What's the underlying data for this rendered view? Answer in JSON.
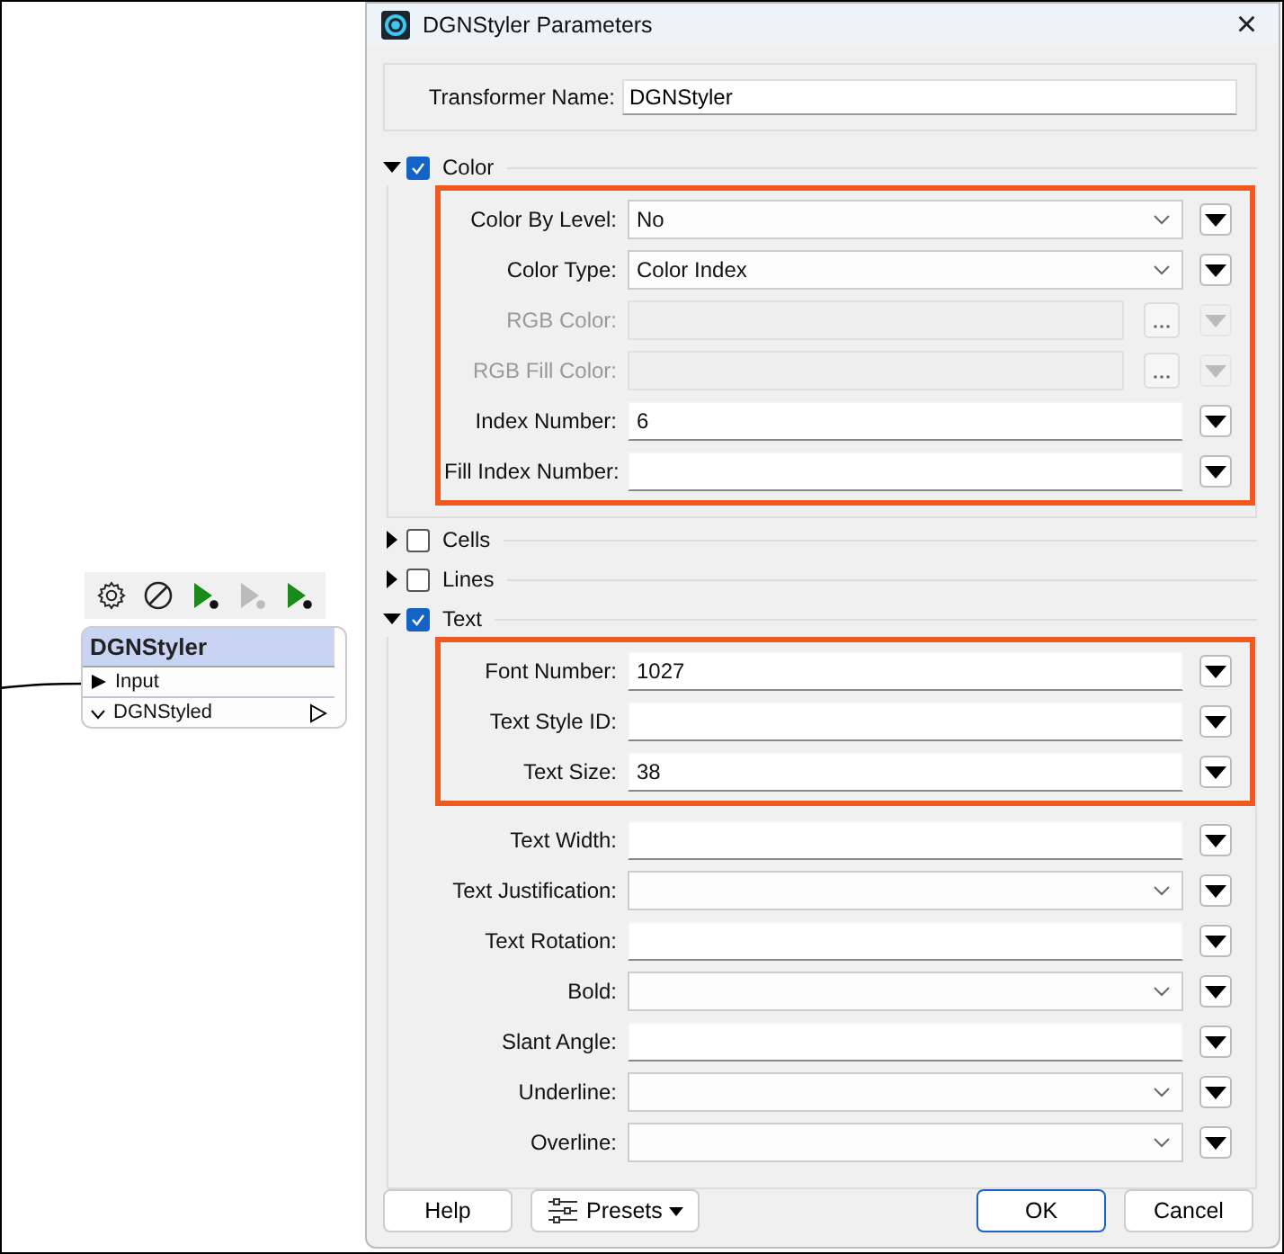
{
  "canvas": {
    "toolbar": [
      {
        "kind": "settings"
      },
      {
        "kind": "disable"
      },
      {
        "kind": "run",
        "disabled": false
      },
      {
        "kind": "run",
        "disabled": true
      },
      {
        "kind": "run",
        "disabled": false
      }
    ],
    "node": {
      "title": "DGNStyler",
      "selected": true,
      "input": "Input",
      "output": "DGNStyled"
    }
  },
  "dialog": {
    "title": "DGNStyler Parameters",
    "close": "×",
    "transformer_name": {
      "label": "Transformer Name:",
      "value": "DGNStyler"
    },
    "groups": [
      {
        "label": "Color",
        "checked": true,
        "expanded": true,
        "blocks": [
          {
            "highlighted": true,
            "params": [
              {
                "label": "Color By Level:",
                "kind": "select",
                "value": "No",
                "disabled": false
              },
              {
                "label": "Color Type:",
                "kind": "select",
                "value": "Color Index",
                "disabled": false
              },
              {
                "label": "RGB Color:",
                "kind": "color",
                "disabled": true
              },
              {
                "label": "RGB Fill Color:",
                "kind": "color",
                "disabled": true
              },
              {
                "label": "Index Number:",
                "kind": "text",
                "value": "6",
                "disabled": false
              },
              {
                "label": "Fill Index Number:",
                "kind": "text",
                "disabled": false
              }
            ]
          }
        ]
      },
      {
        "label": "Cells",
        "checked": false,
        "expanded": false
      },
      {
        "label": "Lines",
        "checked": false,
        "expanded": false
      },
      {
        "label": "Text",
        "checked": true,
        "expanded": true,
        "blocks": [
          {
            "highlighted": true,
            "params": [
              {
                "label": "Font Number:",
                "kind": "text",
                "value": "1027",
                "disabled": false
              },
              {
                "label": "Text Style ID:",
                "kind": "text",
                "disabled": false
              },
              {
                "label": "Text Size:",
                "kind": "text",
                "value": "38",
                "disabled": false
              }
            ]
          },
          {
            "highlighted": false,
            "params": [
              {
                "label": "Text Width:",
                "kind": "text",
                "disabled": false
              },
              {
                "label": "Text Justification:",
                "kind": "select",
                "disabled": false
              },
              {
                "label": "Text Rotation:",
                "kind": "text",
                "disabled": false
              },
              {
                "label": "Bold:",
                "kind": "select",
                "disabled": false
              },
              {
                "label": "Slant Angle:",
                "kind": "text",
                "disabled": false
              },
              {
                "label": "Underline:",
                "kind": "select",
                "disabled": false
              },
              {
                "label": "Overline:",
                "kind": "select",
                "disabled": false
              }
            ]
          }
        ]
      }
    ],
    "buttons": [
      {
        "label": "Help",
        "kind": "plain"
      },
      {
        "label": "Presets",
        "kind": "menu"
      },
      {
        "label": "OK",
        "kind": "default"
      },
      {
        "label": "Cancel",
        "kind": "plain"
      }
    ]
  }
}
